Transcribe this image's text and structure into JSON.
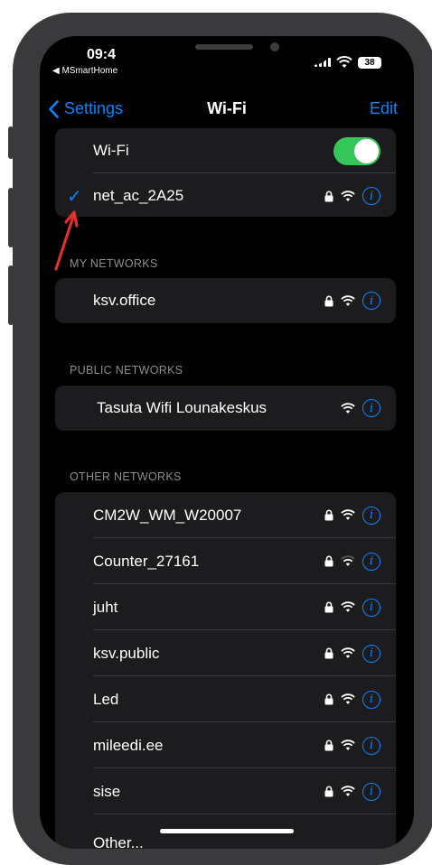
{
  "status": {
    "time": "09:4",
    "back_app": "◀ MSmartHome",
    "battery": "38"
  },
  "nav": {
    "back_label": "Settings",
    "title": "Wi-Fi",
    "edit_label": "Edit"
  },
  "wifi_toggle_label": "Wi-Fi",
  "connected_network": "net_ac_2A25",
  "sections": {
    "my_networks": "MY NETWORKS",
    "public_networks": "PUBLIC NETWORKS",
    "other_networks": "OTHER NETWORKS"
  },
  "my_networks": [
    "ksv.office"
  ],
  "public_networks": [
    "Tasuta Wifi Lounakeskus"
  ],
  "other_networks": [
    "CM2W_WM_W20007",
    "Counter_27161",
    "juht",
    "ksv.public",
    "Led",
    "mileedi.ee",
    "sise",
    "Other..."
  ],
  "colors": {
    "accent": "#0a84ff",
    "toggle_on": "#34c759",
    "annotation_arrow": "#e0302a"
  }
}
